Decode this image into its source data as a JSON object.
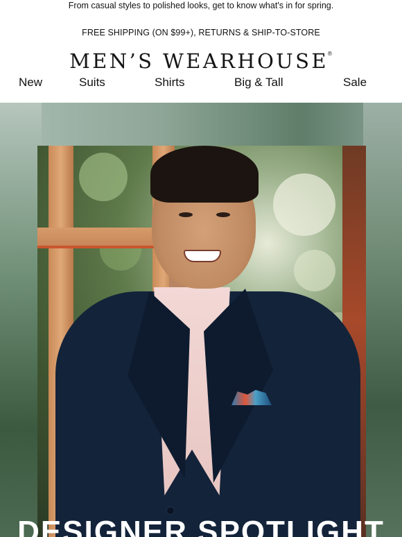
{
  "preheader": "From casual styles to polished looks, get to know what's in for spring.",
  "shipping_banner": "FREE SHIPPING (ON $99+), RETURNS & SHIP-TO-STORE",
  "brand": {
    "name": "MEN’S WEARHOUSE",
    "registered_mark": "®"
  },
  "nav": {
    "items": [
      {
        "label": "New"
      },
      {
        "label": "Suits"
      },
      {
        "label": "Shirts"
      },
      {
        "label": "Big & Tall"
      },
      {
        "label": "Sale"
      }
    ]
  },
  "hero": {
    "headline": "DESIGNER SPOTLIGHT"
  },
  "colors": {
    "background": "#ffffff",
    "text": "#111111",
    "jacket_navy": "#13233a",
    "headline_text": "#ffffff"
  }
}
